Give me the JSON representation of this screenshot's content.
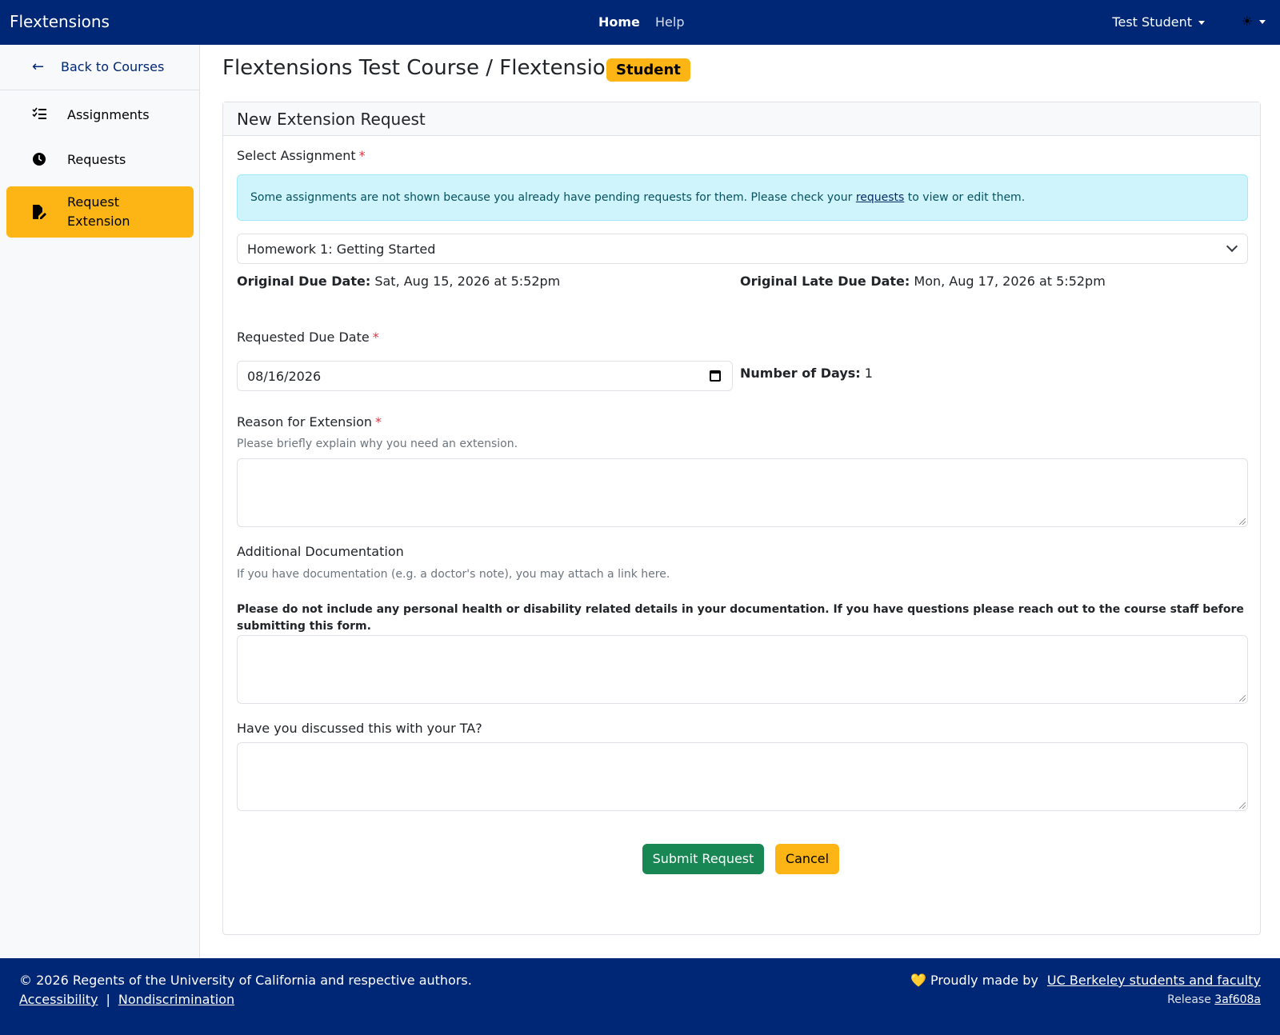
{
  "navbar": {
    "brand": "Flextensions",
    "home": "Home",
    "help": "Help",
    "user": "Test Student",
    "theme_icon": "☀"
  },
  "sidebar": {
    "back": "Back to Courses",
    "items": [
      {
        "label": "Assignments",
        "icon": "list-check-icon"
      },
      {
        "label": "Requests",
        "icon": "clock-icon"
      },
      {
        "label": "Request Extension",
        "icon": "file-edit-icon"
      }
    ]
  },
  "page": {
    "title": "Flextensions Test Course / Flextensions",
    "role_badge": "Student"
  },
  "form": {
    "header": "New Extension Request",
    "select_label": "Select Assignment",
    "required_mark": "*",
    "alert_text_before": "Some assignments are not shown because you already have pending requests for them. Please check your",
    "alert_link": "requests",
    "alert_text_after": "to view or edit them.",
    "assignment_value": "Homework 1: Getting Started",
    "original_due_label": "Original Due Date:",
    "original_due_value": "Sat, Aug 15, 2026 at 5:52pm",
    "late_due_label": "Original Late Due Date:",
    "late_due_value": "Mon, Aug 17, 2026 at 5:52pm",
    "requested_due_label": "Requested Due Date",
    "requested_due_value": "08/16/2026",
    "num_days_label": "Number of Days:",
    "num_days_value": "1",
    "reason_label": "Reason for Extension",
    "reason_help": "Please briefly explain why you need an extension.",
    "reason_value": "",
    "doc_label": "Additional Documentation",
    "doc_help": "If you have documentation (e.g. a doctor's note), you may attach a link here.",
    "doc_warning": "Please do not include any personal health or disability related details in your documentation. If you have questions please reach out to the course staff before submitting this form.",
    "doc_value": "",
    "ta_label": "Have you discussed this with your TA?",
    "ta_value": "",
    "submit": "Submit Request",
    "cancel": "Cancel"
  },
  "footer": {
    "copyright": "© 2026 Regents of the University of California and respective authors.",
    "accessibility": "Accessibility",
    "separator": "|",
    "nondiscrimination": "Nondiscrimination",
    "made_by_heart": "💛",
    "made_by_text": "Proudly made by",
    "made_by_link": "UC Berkeley students and faculty",
    "release_label": "Release",
    "release_hash": "3af608a"
  },
  "colors": {
    "navy": "#002676",
    "gold": "#fdb515",
    "success": "#198754",
    "info_bg": "#cff4fc"
  }
}
